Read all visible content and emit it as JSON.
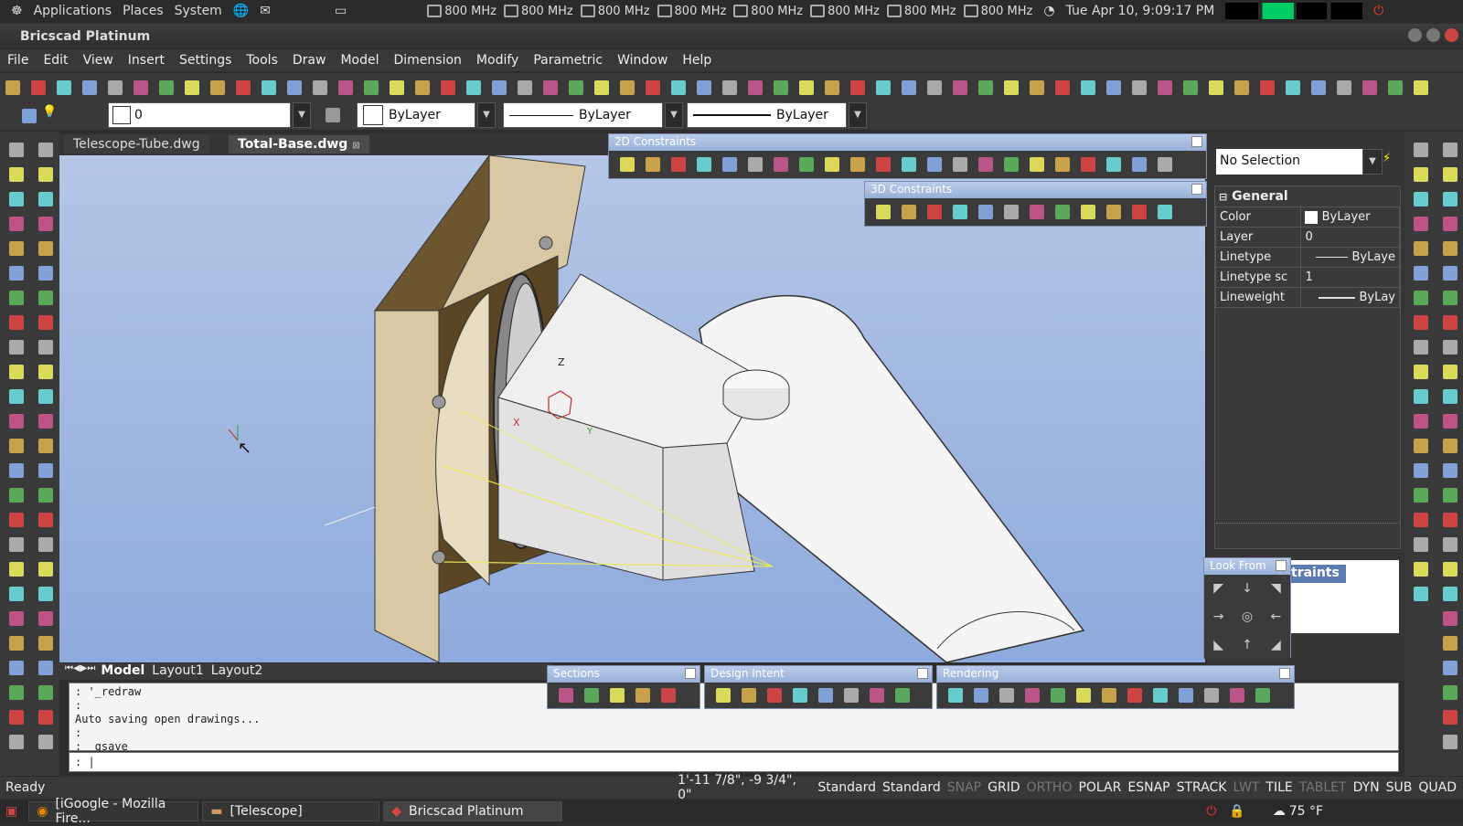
{
  "system_bar": {
    "menus": [
      "Applications",
      "Places",
      "System"
    ],
    "cpus": [
      "800 MHz",
      "800 MHz",
      "800 MHz",
      "800 MHz",
      "800 MHz",
      "800 MHz",
      "800 MHz",
      "800 MHz"
    ],
    "datetime": "Tue Apr 10,  9:09:17 PM"
  },
  "window": {
    "title": "Bricscad Platinum"
  },
  "menu": [
    "File",
    "Edit",
    "View",
    "Insert",
    "Settings",
    "Tools",
    "Draw",
    "Model",
    "Dimension",
    "Modify",
    "Parametric",
    "Window",
    "Help"
  ],
  "layer_toolbar": {
    "layer": "0",
    "color": "ByLayer",
    "linetype": "ByLayer",
    "lineweight": "ByLayer"
  },
  "doc_tabs": [
    "Telescope-Tube.dwg",
    "Total-Base.dwg"
  ],
  "floating": {
    "constraints_2d": "2D Constraints",
    "constraints_3d": "3D Constraints",
    "sections": "Sections",
    "design_intent": "Design Intent",
    "rendering": "Rendering",
    "look_from": "Look From",
    "traints": "traints"
  },
  "properties": {
    "selection": "No Selection",
    "section": "General",
    "rows": [
      {
        "key": "Color",
        "value": "ByLayer"
      },
      {
        "key": "Layer",
        "value": "0"
      },
      {
        "key": "Linetype",
        "value": "ByLaye"
      },
      {
        "key": "Linetype sc",
        "value": "1"
      },
      {
        "key": "Lineweight",
        "value": "ByLay"
      }
    ]
  },
  "viewport": {
    "axis_z": "Z",
    "axis_x": "X",
    "axis_y": "Y"
  },
  "layout_tabs": [
    "Model",
    "Layout1",
    "Layout2"
  ],
  "command": {
    "lines": [
      ":  '_redraw",
      ":",
      "Auto saving open drawings...",
      ":",
      ":  _qsave"
    ],
    "prompt": ": |"
  },
  "status": {
    "ready": "Ready",
    "coords": "1'-11 7/8\", -9 3/4\", 0\"",
    "style1": "Standard",
    "style2": "Standard",
    "toggles": [
      "SNAP",
      "GRID",
      "ORTHO",
      "POLAR",
      "ESNAP",
      "STRACK",
      "LWT",
      "TILE",
      "TABLET",
      "DYN",
      "SUB",
      "QUAD"
    ]
  },
  "taskbar": {
    "tasks": [
      "[iGoogle - Mozilla Fire...",
      "[Telescope]",
      "Bricscad Platinum"
    ],
    "temp": "75 °F"
  }
}
